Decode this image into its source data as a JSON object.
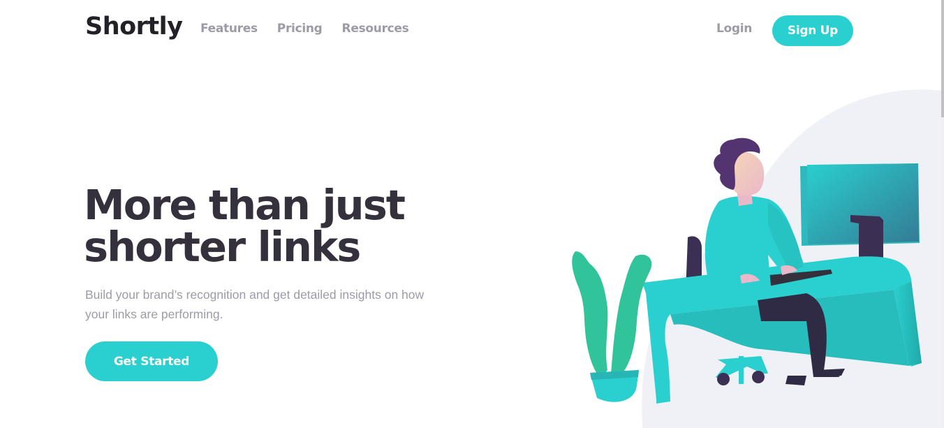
{
  "header": {
    "logo": "Shortly",
    "nav": [
      "Features",
      "Pricing",
      "Resources"
    ],
    "login": "Login",
    "signup": "Sign Up"
  },
  "hero": {
    "title_line1": "More than just",
    "title_line2": "shorter links",
    "subtitle": "Build your brand’s recognition and get detailed insights on how your links are performing.",
    "cta": "Get Started"
  },
  "colors": {
    "primary": "#2acfcf",
    "dark_violet": "#3b3054",
    "grayish_violet": "#9e9aa7",
    "very_dark_blue": "#35323e",
    "illustration_bg": "#f0f1f6"
  },
  "icons": [
    "person-working-illustration"
  ]
}
